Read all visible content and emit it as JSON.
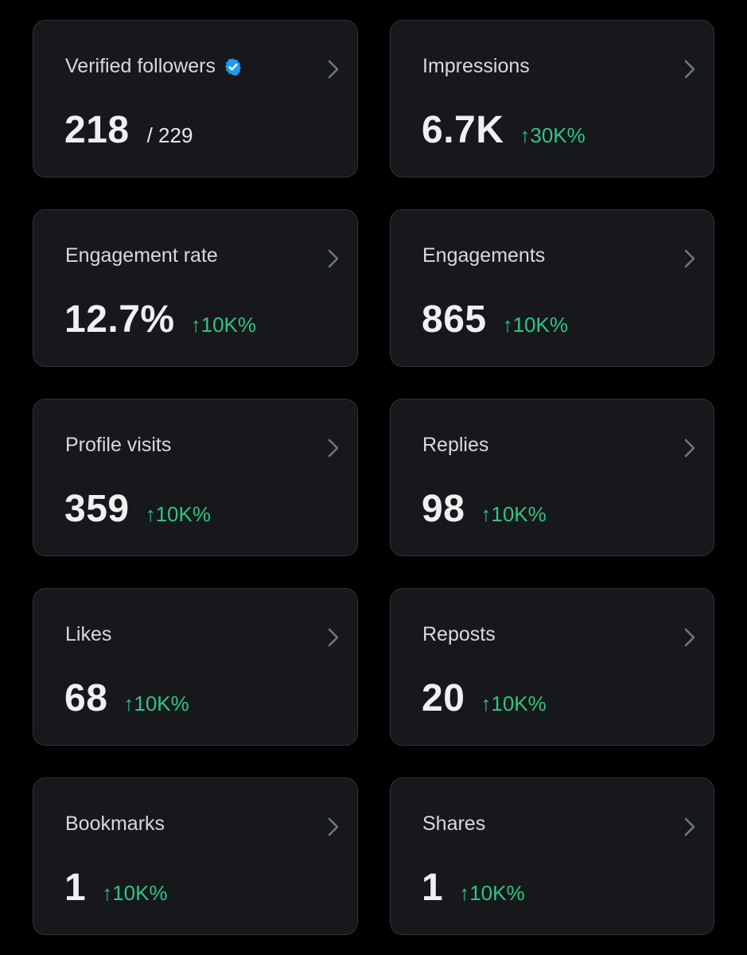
{
  "colors": {
    "background": "#000000",
    "card": "#16181c",
    "card_border": "#2f3336",
    "title_text": "#d9d9d9",
    "value_text": "#eef0f1",
    "positive_change": "#2fc483",
    "verified_badge": "#1d9bf0",
    "chevron": "#71767b"
  },
  "metrics": [
    {
      "title": "Verified followers",
      "value": "218",
      "total": "/ 229",
      "icon": "verified-badge-icon"
    },
    {
      "title": "Impressions",
      "value": "6.7K",
      "change": "↑30K%"
    },
    {
      "title": "Engagement rate",
      "value": "12.7%",
      "change": "↑10K%"
    },
    {
      "title": "Engagements",
      "value": "865",
      "change": "↑10K%"
    },
    {
      "title": "Profile visits",
      "value": "359",
      "change": "↑10K%"
    },
    {
      "title": "Replies",
      "value": "98",
      "change": "↑10K%"
    },
    {
      "title": "Likes",
      "value": "68",
      "change": "↑10K%"
    },
    {
      "title": "Reposts",
      "value": "20",
      "change": "↑10K%"
    },
    {
      "title": "Bookmarks",
      "value": "1",
      "change": "↑10K%"
    },
    {
      "title": "Shares",
      "value": "1",
      "change": "↑10K%"
    }
  ]
}
